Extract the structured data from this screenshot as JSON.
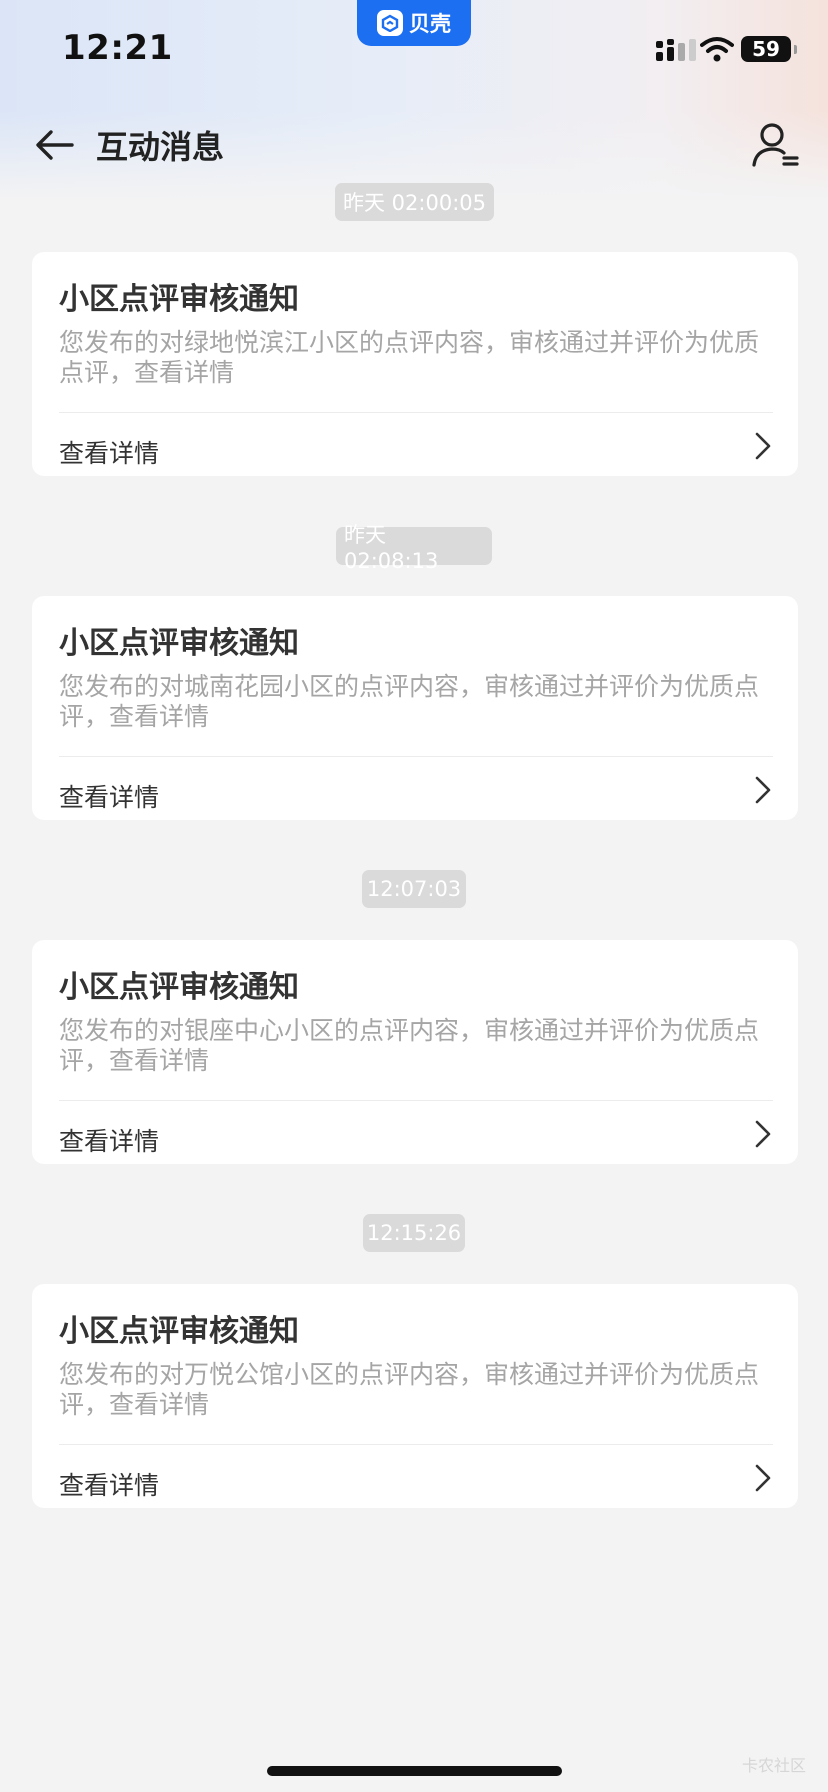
{
  "status_bar": {
    "time": "12:21",
    "app_name": "贝壳",
    "battery": "59"
  },
  "nav": {
    "title": "互动消息"
  },
  "messages": [
    {
      "timestamp": "昨天 02:00:05",
      "title": "小区点评审核通知",
      "body": "您发布的对绿地悦滨江小区的点评内容，审核通过并评价为优质点评，查看详情",
      "action": "查看详情"
    },
    {
      "timestamp": "昨天 02:08:13",
      "title": "小区点评审核通知",
      "body": "您发布的对城南花园小区的点评内容，审核通过并评价为优质点评，查看详情",
      "action": "查看详情"
    },
    {
      "timestamp": "12:07:03",
      "title": "小区点评审核通知",
      "body": "您发布的对银座中心小区的点评内容，审核通过并评价为优质点评，查看详情",
      "action": "查看详情"
    },
    {
      "timestamp": "12:15:26",
      "title": "小区点评审核通知",
      "body": "您发布的对万悦公馆小区的点评内容，审核通过并评价为优质点评，查看详情",
      "action": "查看详情"
    }
  ],
  "watermark": "卡农社区",
  "colors": {
    "accent": "#1d6ff2",
    "background": "#f3f3f4",
    "timestamp_pill": "#dadada",
    "body_text": "#a5a5a5",
    "title_text": "#333333"
  },
  "icons": {
    "back": "arrow-left-icon",
    "profile": "user-settings-icon",
    "chevron": "chevron-right-icon"
  }
}
